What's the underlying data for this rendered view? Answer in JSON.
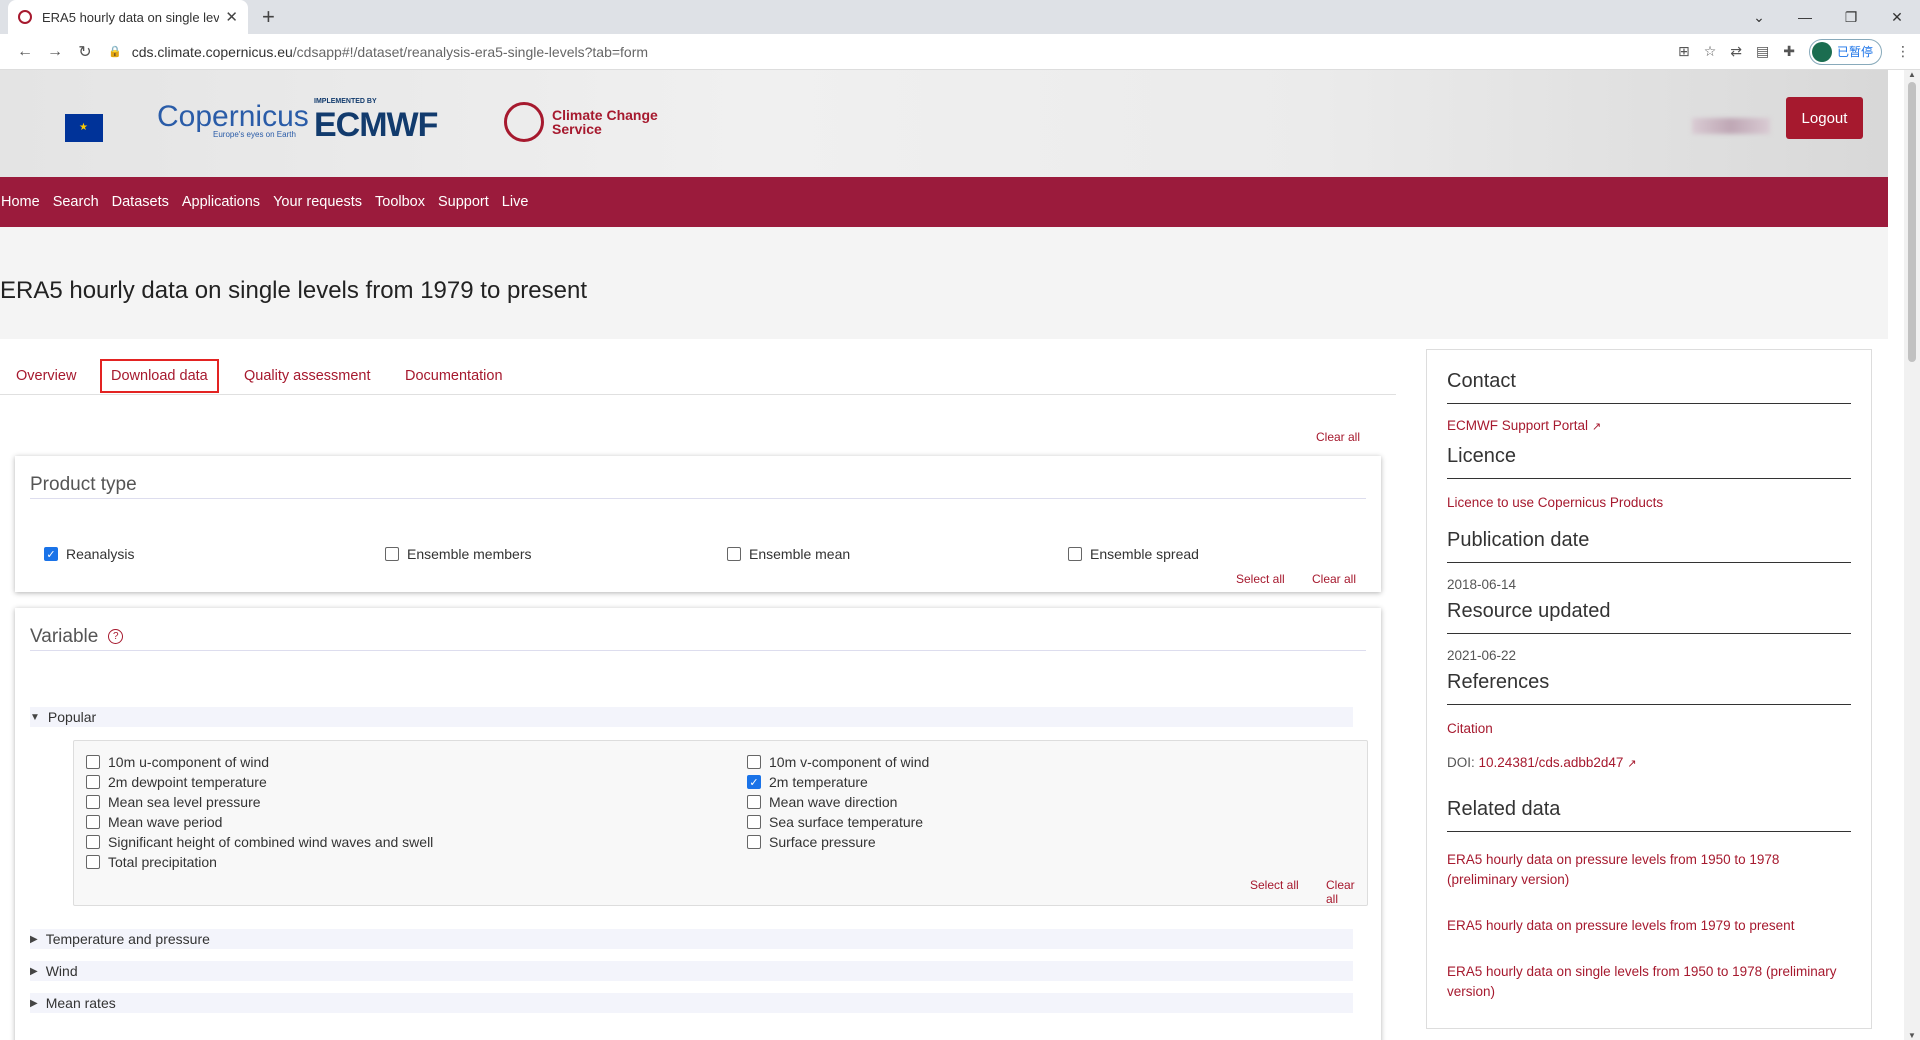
{
  "browser": {
    "tab_title": "ERA5 hourly data on single lev",
    "url_host": "cds.climate.copernicus.eu",
    "url_path": "/cdsapp#!/dataset/reanalysis-era5-single-levels?tab=form",
    "profile_label": "已暂停"
  },
  "header": {
    "copernicus_label": "opernicus",
    "copernicus_tagline": "Europe's eyes on Earth",
    "ecmwf_label": "ECMWF",
    "ecmwf_tag": "IMPLEMENTED BY",
    "c3s_line1": "Climate Change",
    "c3s_line2": "Service",
    "logout_label": "Logout"
  },
  "nav": {
    "items": [
      "Home",
      "Search",
      "Datasets",
      "Applications",
      "Your requests",
      "Toolbox",
      "Support",
      "Live"
    ]
  },
  "page": {
    "title": "ERA5 hourly data on single levels from 1979 to present",
    "tabs": [
      "Overview",
      "Download data",
      "Quality assessment",
      "Documentation"
    ],
    "active_tab": "Download data",
    "clear_all": "Clear all"
  },
  "product_type": {
    "title": "Product type",
    "options": [
      {
        "label": "Reanalysis",
        "checked": true
      },
      {
        "label": "Ensemble members",
        "checked": false
      },
      {
        "label": "Ensemble mean",
        "checked": false
      },
      {
        "label": "Ensemble spread",
        "checked": false
      }
    ],
    "select_all": "Select all",
    "clear_all": "Clear all"
  },
  "variable": {
    "title": "Variable",
    "help_icon": "?",
    "popular_label": "Popular",
    "popular_left": [
      {
        "label": "10m u-component of wind",
        "checked": false
      },
      {
        "label": "2m dewpoint temperature",
        "checked": false
      },
      {
        "label": "Mean sea level pressure",
        "checked": false
      },
      {
        "label": "Mean wave period",
        "checked": false
      },
      {
        "label": "Significant height of combined wind waves and swell",
        "checked": false
      },
      {
        "label": "Total precipitation",
        "checked": false
      }
    ],
    "popular_right": [
      {
        "label": "10m v-component of wind",
        "checked": false
      },
      {
        "label": "2m temperature",
        "checked": true
      },
      {
        "label": "Mean wave direction",
        "checked": false
      },
      {
        "label": "Sea surface temperature",
        "checked": false
      },
      {
        "label": "Surface pressure",
        "checked": false
      }
    ],
    "select_all": "Select all",
    "clear_all": "Clear all",
    "collapsed_sections": [
      "Temperature and pressure",
      "Wind",
      "Mean rates"
    ]
  },
  "sidebar": {
    "contact_title": "Contact",
    "contact_link": "ECMWF Support Portal",
    "licence_title": "Licence",
    "licence_link": "Licence to use Copernicus Products",
    "publication_title": "Publication date",
    "publication_date": "2018-06-14",
    "updated_title": "Resource updated",
    "updated_date": "2021-06-22",
    "references_title": "References",
    "citation_link": "Citation",
    "doi_prefix": "DOI:",
    "doi_link": "10.24381/cds.adbb2d47",
    "related_title": "Related data",
    "related": [
      "ERA5 hourly data on pressure levels from 1950 to 1978 (preliminary version)",
      "ERA5 hourly data on pressure levels from 1979 to present",
      "ERA5 hourly data on single levels from 1950 to 1978 (preliminary version)"
    ]
  },
  "colors": {
    "brand": "#9b1b3c",
    "link": "#a6192e",
    "highlight": "#e32322"
  }
}
